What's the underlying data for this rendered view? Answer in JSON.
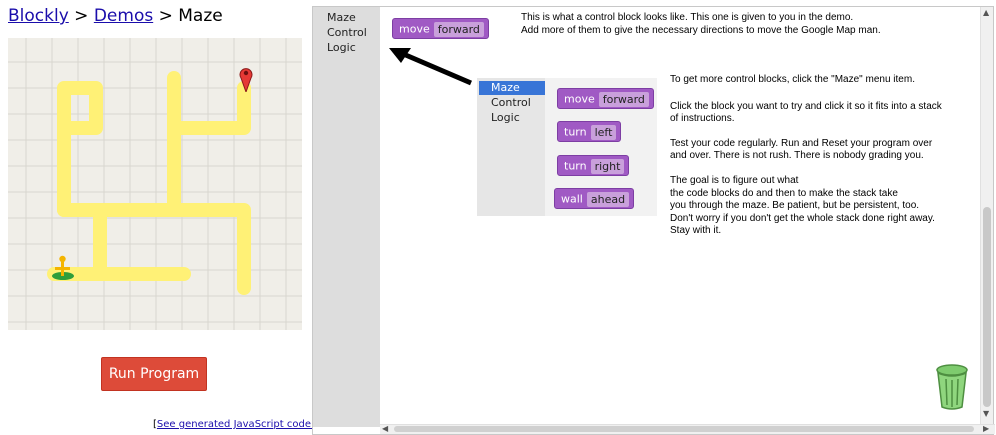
{
  "breadcrumb": {
    "home": "Blockly",
    "sep1": ">",
    "demos": "Demos",
    "sep2": ">",
    "current": "Maze"
  },
  "run_button": "Run Program",
  "generated_link": {
    "open": "[",
    "text": "See generated JavaScript code.",
    "close": "]"
  },
  "toolbox": {
    "items": [
      "Maze",
      "Control",
      "Logic"
    ]
  },
  "main_block": {
    "text": "move",
    "field": "forward"
  },
  "mini_toolbox": {
    "items": [
      "Maze",
      "Control",
      "Logic"
    ],
    "selected": "Maze",
    "blocks": [
      {
        "text": "move",
        "field": "forward"
      },
      {
        "text": "turn",
        "field": "left"
      },
      {
        "text": "turn",
        "field": "right"
      },
      {
        "text": "wall",
        "field": "ahead"
      }
    ]
  },
  "help": {
    "intro_1": "This is what a control block looks like. This one is given to you in the demo.",
    "intro_2": "Add more of them to give the necessary directions to move the Google Map man.",
    "p1": "To get more control blocks, click the \"Maze\" menu item.",
    "p2": "Click the block you want to try and click it so it fits into a stack of instructions.",
    "p3": "Test your code regularly. Run and Reset your program over and over. There is not rush. There is nobody grading you.",
    "p4_1": "The goal is to figure out what",
    "p4_2": "the code blocks do and then to make the stack take",
    "p4_3": "you through the maze. Be patient, but be persistent, too.",
    "p4_4": "Don't worry if you don't get the whole stack done right away.",
    "p4_5": "Stay with it."
  },
  "colors": {
    "block": "#a05ac4",
    "run_button": "#dd4b39",
    "maze_path": "#fff176",
    "maze_bg": "#f0eee8",
    "selection": "#3875d7"
  },
  "icons": {
    "goal": "map-marker-icon",
    "player": "pegman-icon",
    "trash": "trash-can-icon",
    "arrow": "pointer-arrow-icon"
  }
}
